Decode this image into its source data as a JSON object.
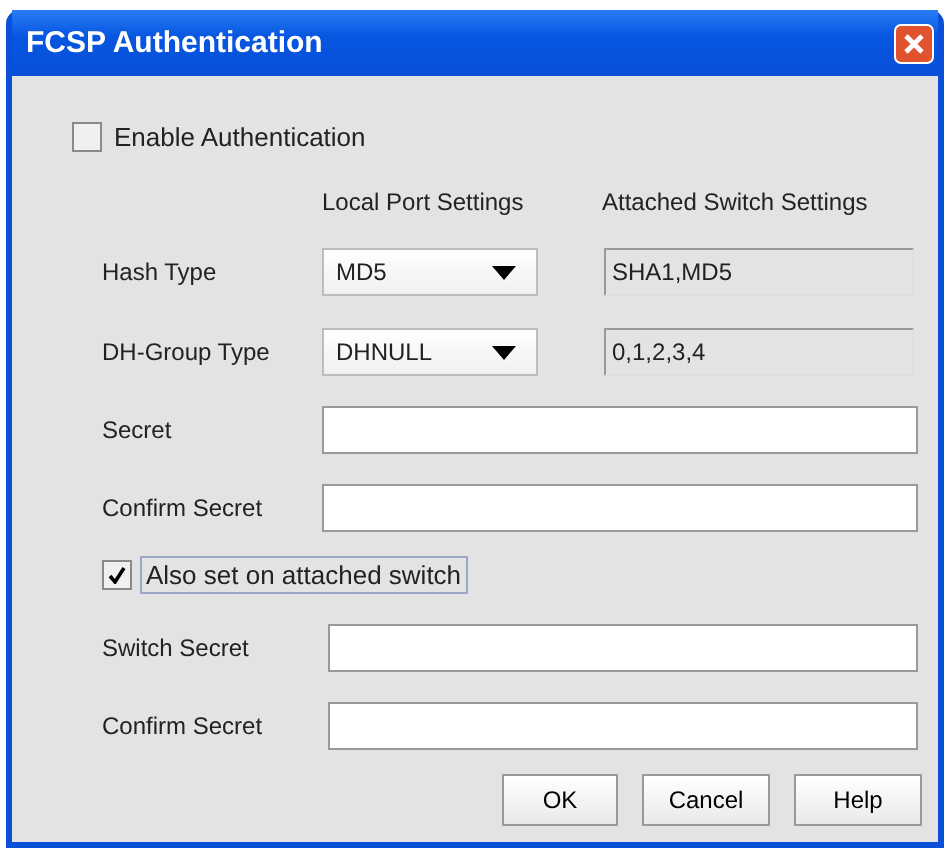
{
  "window": {
    "title": "FCSP Authentication"
  },
  "enable_authentication": {
    "label": "Enable Authentication",
    "checked": false
  },
  "column_headers": [
    "Local Port Settings",
    "Attached Switch Settings"
  ],
  "settings": [
    {
      "label": "Hash Type",
      "local_value": "MD5",
      "attached_value": "SHA1,MD5"
    },
    {
      "label": "DH-Group Type",
      "local_value": "DHNULL",
      "attached_value": "0,1,2,3,4"
    }
  ],
  "secret_fields": [
    {
      "label": "Secret"
    },
    {
      "label": "Confirm Secret"
    }
  ],
  "also_set": {
    "label": "Also set on attached switch",
    "checked": true
  },
  "switch_secret_fields": [
    {
      "label": "Switch Secret"
    },
    {
      "label": "Confirm Secret"
    }
  ],
  "buttons": [
    "OK",
    "Cancel",
    "Help"
  ]
}
